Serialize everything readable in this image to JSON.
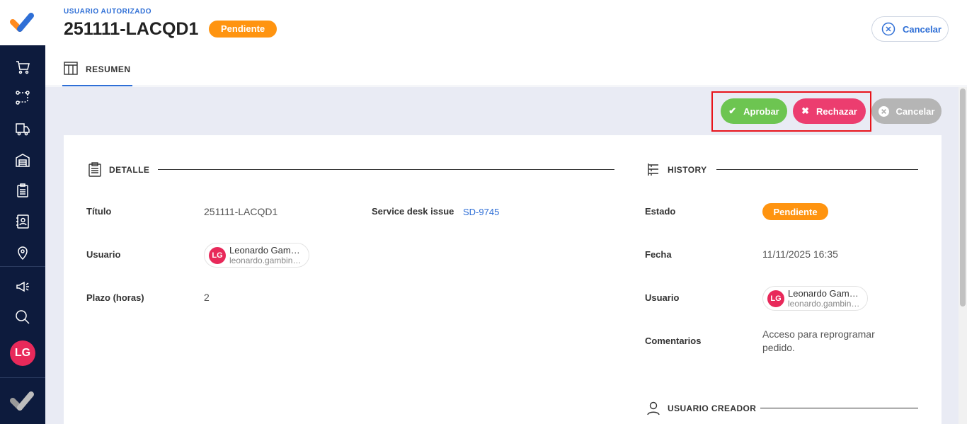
{
  "header": {
    "subtitle": "USUARIO AUTORIZADO",
    "title": "251111-LACQD1",
    "status": "Pendiente",
    "cancel_label": "Cancelar"
  },
  "tabs": [
    {
      "label": "RESUMEN",
      "active": true
    }
  ],
  "actions": {
    "approve": "Aprobar",
    "reject": "Rechazar",
    "cancel": "Cancelar"
  },
  "sidebar": {
    "icons": [
      "cart-icon",
      "route-icon",
      "truck-icon",
      "warehouse-icon",
      "clipboard-icon",
      "contacts-icon",
      "location-pin-icon",
      "megaphone-icon",
      "search-icon"
    ],
    "avatar": "LG"
  },
  "detalle": {
    "title": "DETALLE",
    "fields": {
      "titulo_label": "Título",
      "titulo_value": "251111-LACQD1",
      "sd_label": "Service desk issue",
      "sd_value": "SD-9745",
      "usuario_label": "Usuario",
      "plazo_label": "Plazo (horas)",
      "plazo_value": "2"
    },
    "user": {
      "initials": "LG",
      "name": "Leonardo Gam…",
      "email": "leonardo.gambin…"
    }
  },
  "history": {
    "title": "HISTORY",
    "estado_label": "Estado",
    "estado_value": "Pendiente",
    "fecha_label": "Fecha",
    "fecha_value": "11/11/2025 16:35",
    "usuario_label": "Usuario",
    "user": {
      "initials": "LG",
      "name": "Leonardo Gam…",
      "email": "leonardo.gambin…"
    },
    "comentarios_label": "Comentarios",
    "comentarios_value": "Acceso para reprogramar pedido."
  },
  "creador": {
    "title": "USUARIO CREADOR"
  },
  "colors": {
    "sidebar": "#0d1b3d",
    "accent": "#2f6fd6",
    "pending": "#ff9410",
    "approve": "#6dc551",
    "reject": "#ec3d6f",
    "cancel": "#b5b5b5",
    "highlight": "#e8131b"
  }
}
